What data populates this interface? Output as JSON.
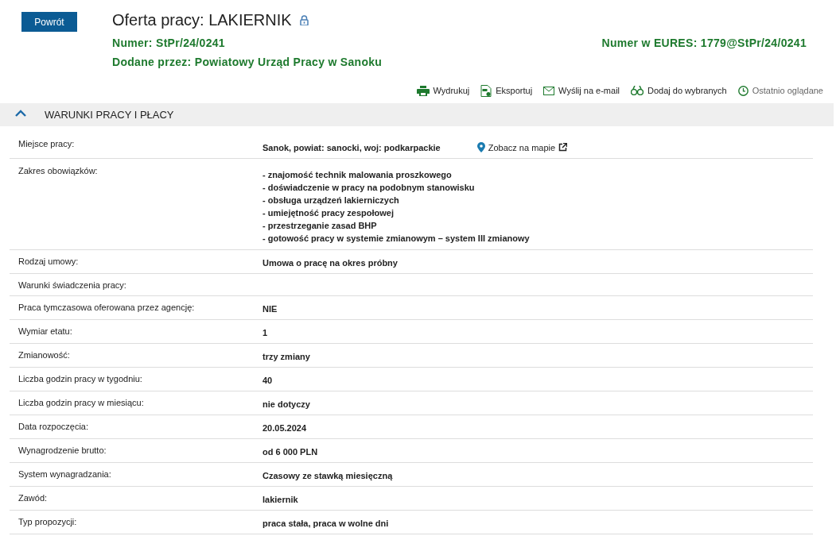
{
  "back_button": "Powrót",
  "title": "Oferta pracy: LAKIERNIK",
  "locked": true,
  "number": {
    "label": "Numer:",
    "value": "StPr/24/0241"
  },
  "eures_number": {
    "label": "Numer w EURES:",
    "value": "1779@StPr/24/0241"
  },
  "added_by": {
    "label": "Dodane przez:",
    "value": "Powiatowy Urząd Pracy w Sanoku"
  },
  "actions": [
    {
      "kind": "print",
      "label": "Wydrukuj",
      "dimmed": false
    },
    {
      "kind": "pdf",
      "label": "Eksportuj",
      "dimmed": false
    },
    {
      "kind": "mail",
      "label": "Wyślij na e-mail",
      "dimmed": false
    },
    {
      "kind": "glasses",
      "label": "Dodaj do wybranych",
      "dimmed": false
    },
    {
      "kind": "clock",
      "label": "Ostatnio oglądane",
      "dimmed": true
    }
  ],
  "section": {
    "title": "WARUNKI PRACY I PŁACY",
    "expanded": true,
    "rows": [
      {
        "label": "Miejsce pracy:",
        "lines": [
          "Sanok, powiat: sanocki, woj: podkarpackie"
        ],
        "map_link": "Zobacz na mapie"
      },
      {
        "label": "Zakres obowiązków:",
        "lines": [
          "- znajomość technik malowania proszkowego",
          "- doświadczenie w pracy na podobnym stanowisku",
          "- obsługa urządzeń lakierniczych",
          "- umiejętność pracy zespołowej",
          "- przestrzeganie zasad BHP",
          "- gotowość pracy w systemie zmianowym – system III zmianowy"
        ]
      },
      {
        "label": "Rodzaj umowy:",
        "lines": [
          "Umowa o pracę na okres próbny"
        ]
      },
      {
        "label": "Warunki świadczenia pracy:"
      },
      {
        "label": "Praca tymczasowa oferowana przez agencję:",
        "lines": [
          "NIE"
        ]
      },
      {
        "label": "Wymiar etatu:",
        "lines": [
          "1"
        ]
      },
      {
        "label": "Zmianowość:",
        "lines": [
          "trzy zmiany"
        ]
      },
      {
        "label": "Liczba godzin pracy w tygodniu:",
        "lines": [
          "40"
        ]
      },
      {
        "label": "Liczba godzin pracy w miesiącu:",
        "lines": [
          "nie dotyczy"
        ]
      },
      {
        "label": "Data rozpoczęcia:",
        "lines": [
          "20.05.2024"
        ]
      },
      {
        "label": "Wynagrodzenie brutto:",
        "lines": [
          "od 6 000 PLN"
        ]
      },
      {
        "label": "System wynagradzania:",
        "lines": [
          "Czasowy ze stawką miesięczną"
        ]
      },
      {
        "label": "Zawód:",
        "lines": [
          "lakiernik"
        ]
      },
      {
        "label": "Typ propozycji:",
        "lines": [
          "praca stała, praca w wolne dni"
        ]
      }
    ]
  }
}
